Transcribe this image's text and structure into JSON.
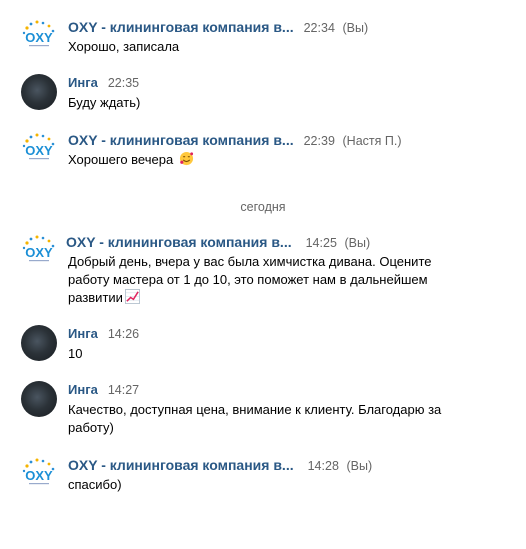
{
  "divider_label": "сегодня",
  "messages": [
    {
      "author": "OXY - клининговая компания в...",
      "time": "22:34",
      "suffix": "(Вы)",
      "text": "Хорошо, записала"
    },
    {
      "author": "Инга",
      "time": "22:35",
      "suffix": "",
      "text": "Буду ждать)"
    },
    {
      "author": "OXY - клининговая компания в...",
      "time": "22:39",
      "suffix": "(Настя П.)",
      "text": "Хорошего вечера"
    },
    {
      "author": "OXY - клининговая компания в...",
      "time": "14:25",
      "suffix": "(Вы)",
      "text": "Добрый день, вчера у вас была химчистка дивана. Оцените работу мастера от 1 до 10, это поможет нам в дальнейшем развитии"
    },
    {
      "author": "Инга",
      "time": "14:26",
      "suffix": "",
      "text": "10"
    },
    {
      "author": "Инга",
      "time": "14:27",
      "suffix": "",
      "text": "Качество, доступная цена, внимание к клиенту. Благодарю за работу)"
    },
    {
      "author": "OXY - клининговая компания в...",
      "time": "14:28",
      "suffix": "(Вы)",
      "text": "спасибо)"
    }
  ],
  "icons": {
    "logo": "oxy-logo-icon",
    "emoji_smile": "smiling-face-with-hearts-icon",
    "emoji_chart": "chart-increasing-icon"
  },
  "colors": {
    "author": "#2a5885",
    "time": "#656565",
    "text": "#000000"
  }
}
